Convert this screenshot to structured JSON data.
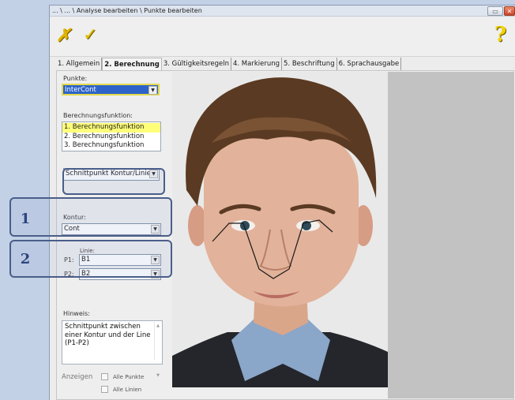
{
  "window": {
    "title": "... \\ ... \\ Analyse bearbeiten \\ Punkte bearbeiten"
  },
  "toolbar": {
    "cancel_icon": "cancel-icon",
    "ok_icon": "ok-icon",
    "help_icon": "help-icon"
  },
  "tabs": [
    {
      "label": "1. Allgemein",
      "active": false
    },
    {
      "label": "2. Berechnung",
      "active": true
    },
    {
      "label": "3. Gültigkeitsregeln",
      "active": false
    },
    {
      "label": "4. Markierung",
      "active": false
    },
    {
      "label": "5. Beschriftung",
      "active": false
    },
    {
      "label": "6. Sprachausgabe",
      "active": false
    }
  ],
  "form": {
    "punkte_label": "Punkte:",
    "punkte_value": "InterCont",
    "calc_label": "Berechnungsfunktion:",
    "calc_items": [
      "1. Berechnungsfunktion",
      "2. Berechnungsfunktion",
      "3. Berechnungsfunktion"
    ],
    "calc_selected_index": 0,
    "method_value": "Schnittpunkt Kontur/Linie",
    "kontur_label": "Kontur:",
    "kontur_value": "Cont",
    "linie_label": "Linie:",
    "p1_label": "P1:",
    "p1_value": "B1",
    "p2_label": "P2:",
    "p2_value": "B2",
    "hinweis_label": "Hinweis:",
    "hinweis_text": "Schnittpunkt zwischen einer Kontur und der Line (P1-P2)",
    "anzeigen_label": "Anzeigen",
    "alle_punkte_label": "Alle Punkte",
    "alle_linien_label": "Alle Linien"
  },
  "callouts": {
    "marker1": "1",
    "marker2": "2"
  },
  "colors": {
    "accent_highlight": "#ffff7a",
    "selected_combo": "#2d63c8",
    "callout_border": "#4a5e8a"
  }
}
